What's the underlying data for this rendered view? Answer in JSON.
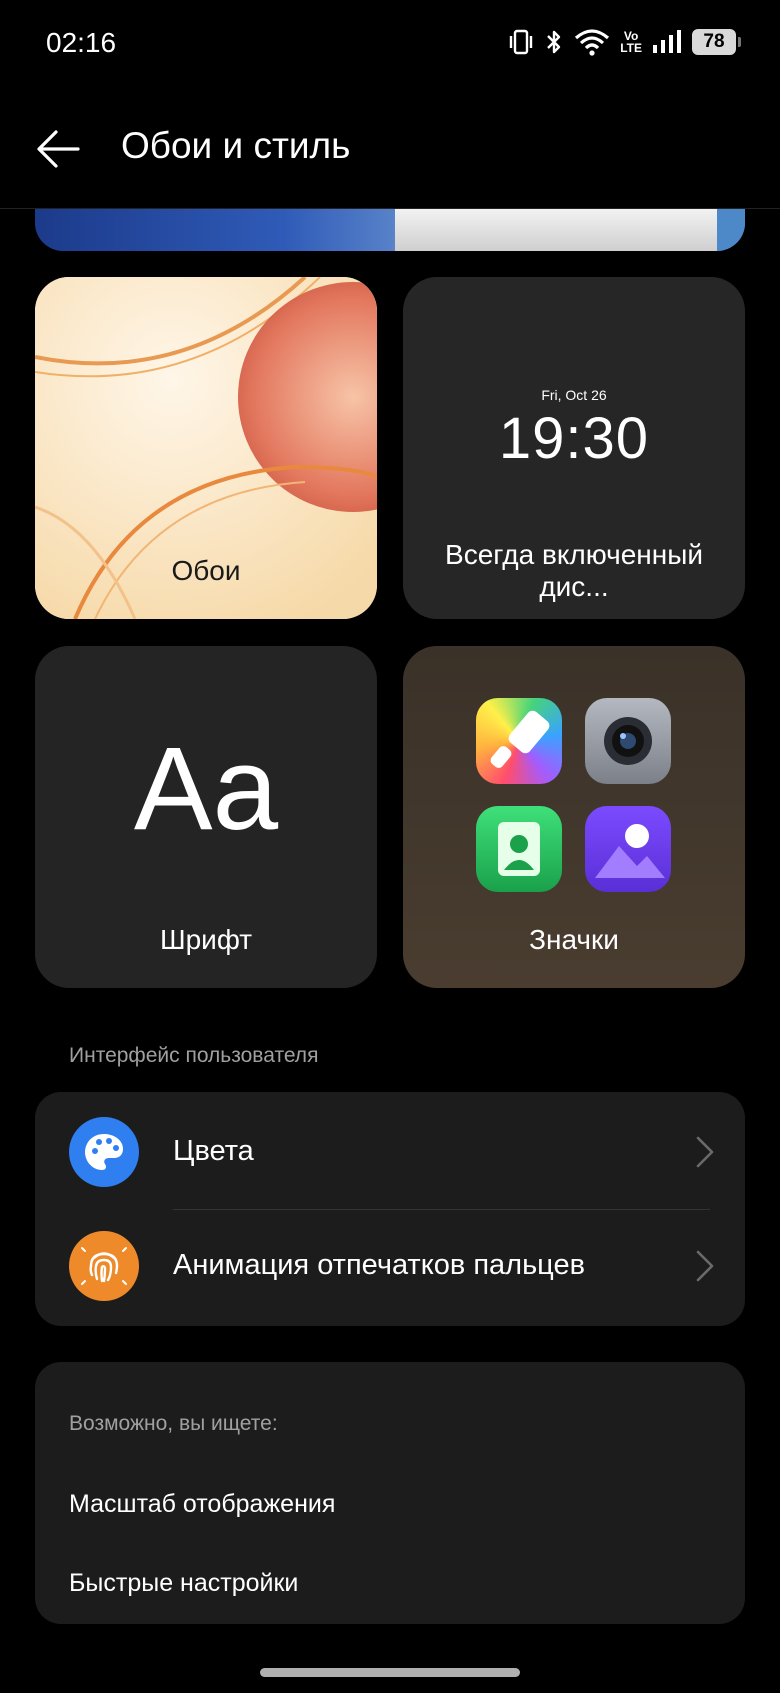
{
  "status_bar": {
    "time": "02:16",
    "icons": [
      "vibrate-icon",
      "bluetooth-icon",
      "wifi-icon",
      "volte-icon",
      "signal-icon",
      "battery-icon"
    ],
    "volte_top": "Vo",
    "volte_bottom": "LTE",
    "battery_level": "78"
  },
  "app_bar": {
    "back_icon": "arrow-left-icon",
    "title": "Обои и стиль"
  },
  "tiles": {
    "wallpaper": {
      "label": "Обои"
    },
    "aod": {
      "date": "Fri, Oct 26",
      "time": "19:30",
      "label": "Всегда включенный дис..."
    },
    "font": {
      "sample": "Aa",
      "label": "Шрифт"
    },
    "icons": {
      "label": "Значки",
      "icons": [
        "paint-brush-app-icon",
        "camera-app-icon",
        "contacts-app-icon",
        "gallery-app-icon"
      ]
    }
  },
  "ui_section": {
    "header": "Интерфейс пользователя",
    "items": [
      {
        "label": "Цвета",
        "icon": "palette-icon",
        "color": "#2f7ff0"
      },
      {
        "label": "Анимация отпечатков пальцев",
        "icon": "fingerprint-icon",
        "color": "#ee8a2a"
      }
    ]
  },
  "suggestions": {
    "title": "Возможно, вы ищете:",
    "items": [
      "Масштаб отображения",
      "Быстрые настройки"
    ]
  }
}
